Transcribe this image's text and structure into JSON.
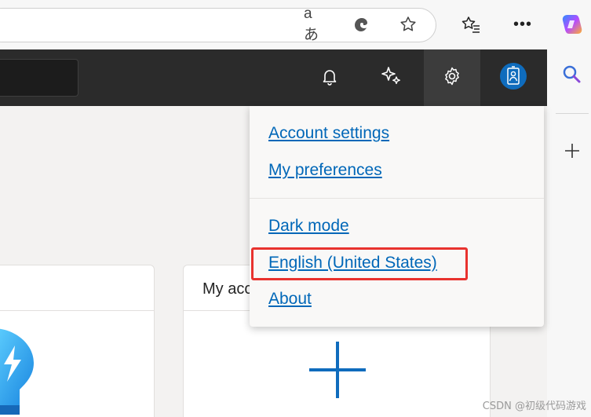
{
  "toolbar": {
    "read_aloud_glyph": "aあ"
  },
  "menu": {
    "items": [
      {
        "label": "Account settings"
      },
      {
        "label": "My preferences"
      },
      {
        "label": "Dark mode"
      },
      {
        "label": "English (United States)"
      },
      {
        "label": "About"
      }
    ]
  },
  "cards": {
    "right_title_visible": "My acc"
  },
  "watermark": "CSDN @初级代码游戏",
  "colors": {
    "accent": "#0067b8",
    "header_bg": "#2b2b2b",
    "highlight": "#e8322e"
  }
}
